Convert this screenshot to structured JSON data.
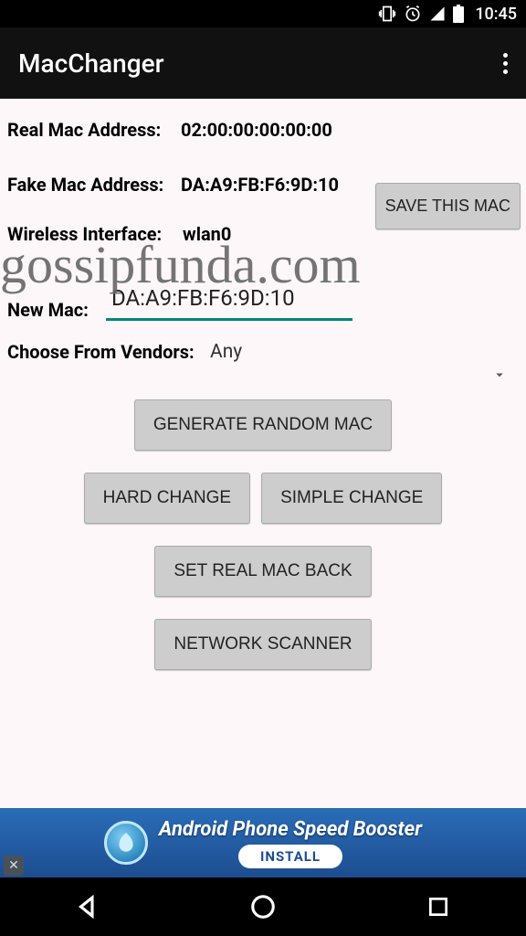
{
  "status": {
    "time": "10:45"
  },
  "appbar": {
    "title": "MacChanger"
  },
  "watermark": "gossipfunda.com",
  "fields": {
    "real_mac_label": "Real Mac Address:",
    "real_mac_value": "02:00:00:00:00:00",
    "fake_mac_label": "Fake Mac Address:",
    "fake_mac_value": "DA:A9:FB:F6:9D:10",
    "iface_label": "Wireless Interface:",
    "iface_value": "wlan0",
    "new_mac_label": "New Mac:",
    "new_mac_value": "DA:A9:FB:F6:9D:10",
    "vendor_label": "Choose From Vendors:",
    "vendor_value": "Any"
  },
  "buttons": {
    "save": "SAVE THIS MAC",
    "generate": "GENERATE RANDOM MAC",
    "hard": "HARD CHANGE",
    "simple": "SIMPLE CHANGE",
    "setreal": "SET REAL MAC BACK",
    "scanner": "NETWORK SCANNER"
  },
  "ad": {
    "title": "Android Phone Speed Booster",
    "cta": "INSTALL"
  }
}
